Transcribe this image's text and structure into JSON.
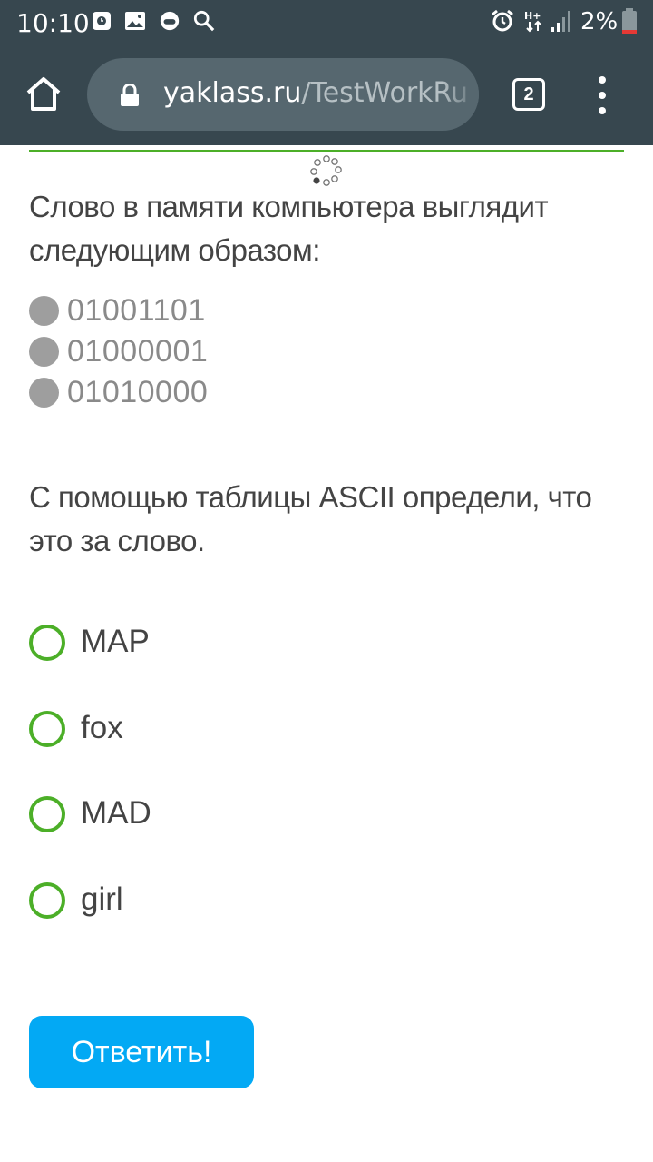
{
  "status_bar": {
    "time": "10:10",
    "battery_percent": "2%",
    "left_icons": [
      "alarm-app-icon",
      "gallery-icon",
      "game-icon",
      "search-icon"
    ],
    "right_icons": [
      "alarm-clock-icon",
      "data-hplus-icon",
      "signal-icon",
      "battery-icon"
    ]
  },
  "browser": {
    "url_host": "yaklass.ru",
    "url_path": "/TestWorkRu",
    "tab_count": "2"
  },
  "question": {
    "text": "Слово в памяти компьютера выглядит следующим образом:",
    "bytes": [
      "01001101",
      "01000001",
      "01010000"
    ],
    "instruction": "С помощью таблицы ASCII определи, что это за слово."
  },
  "options": [
    "MAP",
    "fox",
    "MAD",
    "girl"
  ],
  "submit_label": "Ответить!",
  "colors": {
    "toolbar": "#37474f",
    "accent_green": "#4caf28",
    "button_blue": "#03a9f4"
  }
}
